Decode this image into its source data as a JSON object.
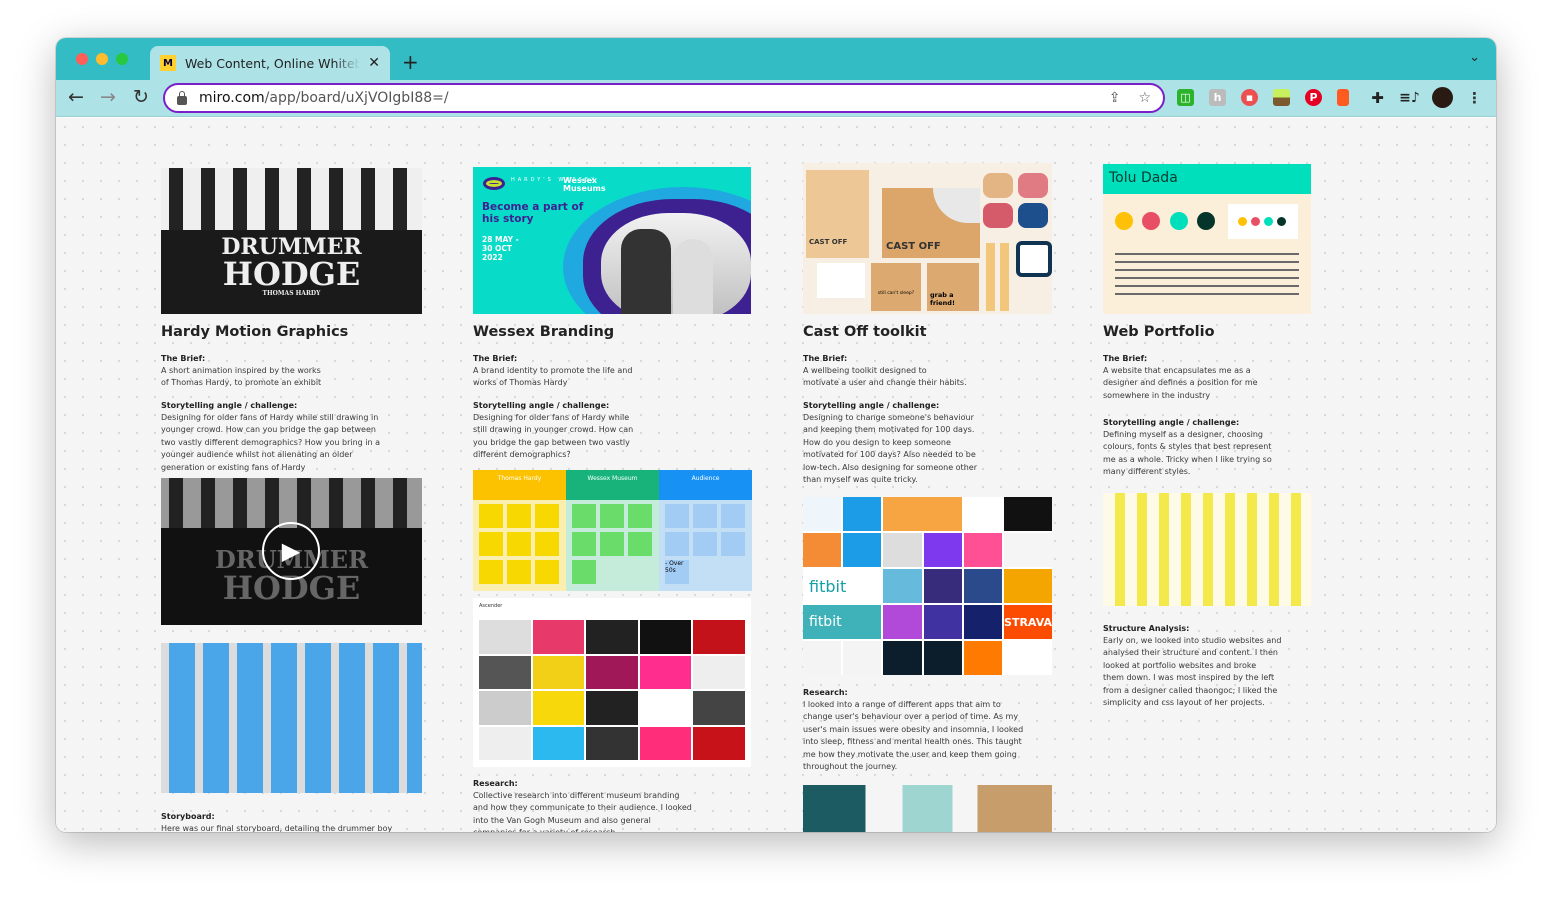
{
  "browser": {
    "tab_title": "Web Content, Online Whiteboard",
    "url_host": "miro.com",
    "url_path": "/app/board/uXjVOIgbI88=/",
    "extensions": [
      "green-extension-icon",
      "h-extension-icon",
      "red-record-icon",
      "plant-extension-icon",
      "pinterest-icon",
      "lighthouse-icon",
      "puzzle-icon",
      "media-queue-icon",
      "profile-avatar"
    ],
    "colors": {
      "tabbar": "#33bcc4",
      "toolbar": "#ade3e6",
      "omnibox_border": "#7b1fc9"
    }
  },
  "columns": [
    {
      "title": "Hardy Motion Graphics",
      "cover": {
        "line1": "DRUMMER",
        "line2": "HODGE",
        "byline": "THOMAS HARDY"
      },
      "brief_label": "The Brief:",
      "brief": "A short animation inspired by the works\nof Thomas Hardy, to promote an exhibit",
      "challenge_label": "Storytelling angle / challenge:",
      "challenge": "Designing for older fans of Hardy while still drawing in\nyounger crowd. How can you bridge the gap between\ntwo vastly different demographics? How you bring in a\nyounger audience whilst not alienating an older\ngeneration or existing fans of Hardy",
      "video": {
        "line1": "DRUMMER",
        "line2": "HODGE"
      },
      "section_label": "Storyboard:",
      "section_text": "Here was our final storyboard, detailing the drummer boy"
    },
    {
      "title": "Wessex Branding",
      "cover": {
        "brand": "HARDY'S WESSEX",
        "museum": "Wessex Museums",
        "headline": "Become a part of his story",
        "dates": "28 MAY -\n30 OCT\n2022"
      },
      "brief_label": "The Brief:",
      "brief": "A brand identity to promote the life and\nworks of Thomas Hardy",
      "challenge_label": "Storytelling angle / challenge:",
      "challenge": "Designing for older fans of Hardy while\nstill drawing in younger crowd. How can\nyou bridge the gap between two vastly\ndifferent demographics?",
      "board_headers": [
        "Thomas Hardy",
        "Wessex Museum",
        "Audience"
      ],
      "board_notes": [
        "Forward thinker",
        "\"Wars focused character\"",
        "\"Feeling back the layers\"",
        "connection",
        "empathy",
        "Thomas Hardy Fans",
        "- Schools and formal learners",
        "- Tourists and visitors",
        "- Over 50s"
      ],
      "moodboard_label": "Ascender",
      "section_label": "Research:",
      "section_text": "Collective research into different museum branding\nand how they communicate to their audience. I looked\ninto the Van Gogh Museum and also general\ncompanies for a variety of research"
    },
    {
      "title": "Cast Off toolkit",
      "cover": {
        "book": "CAST OFF",
        "box": "CAST OFF",
        "card1": "still can't sleep?",
        "card2": "grab a friend!"
      },
      "brief_label": "The Brief:",
      "brief": "A  wellbeing toolkit designed to\nmotivate a user and change their habits.",
      "challenge_label": "Storytelling angle / challenge:",
      "challenge": "Designing to change someone's behaviour\nand keeping them motivated for 100 days.\nHow do you design to keep someone\nmotivated for 100 days? Also needed to be\nlow-tech. Also designing for someone other\nthan myself was quite tricky.",
      "apps": [
        "fitbit",
        "fitbit",
        "STRAVA"
      ],
      "section_label": "Research:",
      "section_text": "I looked into a range of different apps that aim to\nchange user's behaviour over a period of time. As my\nuser's main issues were obesity and insomnia, I looked\ninto sleep, fitness and mental health ones. This taught\nme how they motivate the user and keep them going\nthroughout the journey."
    },
    {
      "title": "Web Portfolio",
      "cover": {
        "name": "Tolu Dada",
        "palette": [
          "#ffc107",
          "#e94f64",
          "#00dfbb",
          "#05342a"
        ]
      },
      "brief_label": "The Brief:",
      "brief": "A website that encapsulates me as a\ndesigner and defines a position for me\nsomewhere in the industry",
      "challenge_label": "Storytelling angle / challenge:",
      "challenge": "Defining myself as a designer, choosing\ncolours, fonts & styles that best represent\nme as a whole. Tricky when I like trying so\nmany different styles.",
      "section_label": "Structure Analysis:",
      "section_text": "Early on, we looked into studio websites and\nanalysed their structure and content. I then\nlooked at portfolio websites and broke\nthem down. I was most inspired by the left\nfrom a designer called thaongoc; I liked the\nsimplicity and css layout of her projects."
    }
  ]
}
